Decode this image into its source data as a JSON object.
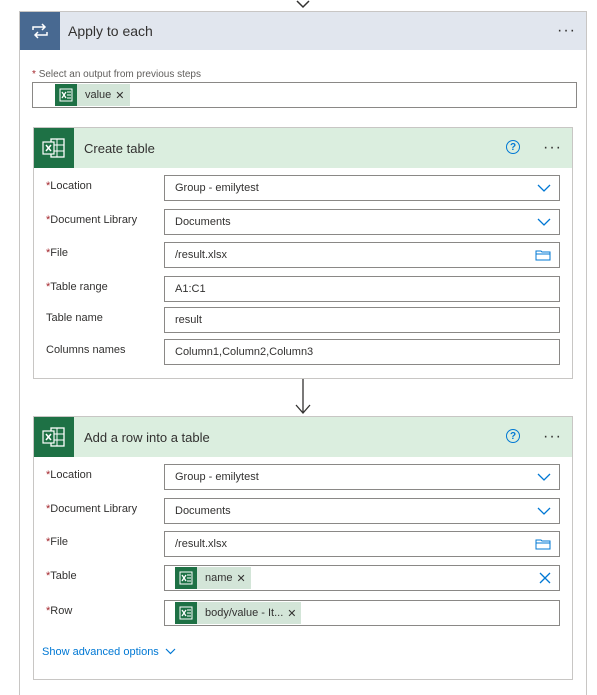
{
  "apply": {
    "title": "Apply to each",
    "select_label": "Select an output from previous steps",
    "select_token": "value"
  },
  "create_table": {
    "title": "Create table",
    "fields": [
      {
        "label": "Location",
        "required": true,
        "value": "Group - emilytest",
        "control": "dropdown"
      },
      {
        "label": "Document Library",
        "required": true,
        "value": "Documents",
        "control": "dropdown"
      },
      {
        "label": "File",
        "required": true,
        "value": "/result.xlsx",
        "control": "folder"
      },
      {
        "label": "Table range",
        "required": true,
        "value": "A1:C1",
        "control": "text"
      },
      {
        "label": "Table name",
        "required": false,
        "value": "result",
        "control": "text"
      },
      {
        "label": "Columns names",
        "required": false,
        "value": "Column1,Column2,Column3",
        "control": "text"
      }
    ]
  },
  "add_row": {
    "title": "Add a row into a table",
    "fields": [
      {
        "label": "Location",
        "required": true,
        "value": "Group - emilytest",
        "control": "dropdown"
      },
      {
        "label": "Document Library",
        "required": true,
        "value": "Documents",
        "control": "dropdown"
      },
      {
        "label": "File",
        "required": true,
        "value": "/result.xlsx",
        "control": "folder"
      },
      {
        "label": "Table",
        "required": true,
        "token": "name",
        "control": "token-clear"
      },
      {
        "label": "Row",
        "required": true,
        "token": "body/value - It...",
        "control": "token"
      }
    ],
    "advanced_label": "Show advanced options"
  },
  "colors": {
    "apply_header": "#e1e6ee",
    "apply_icon": "#486991",
    "action_header": "#dbeedf",
    "excel_green": "#1e7145",
    "link_blue": "#0078d4",
    "required_red": "#a4262c"
  }
}
